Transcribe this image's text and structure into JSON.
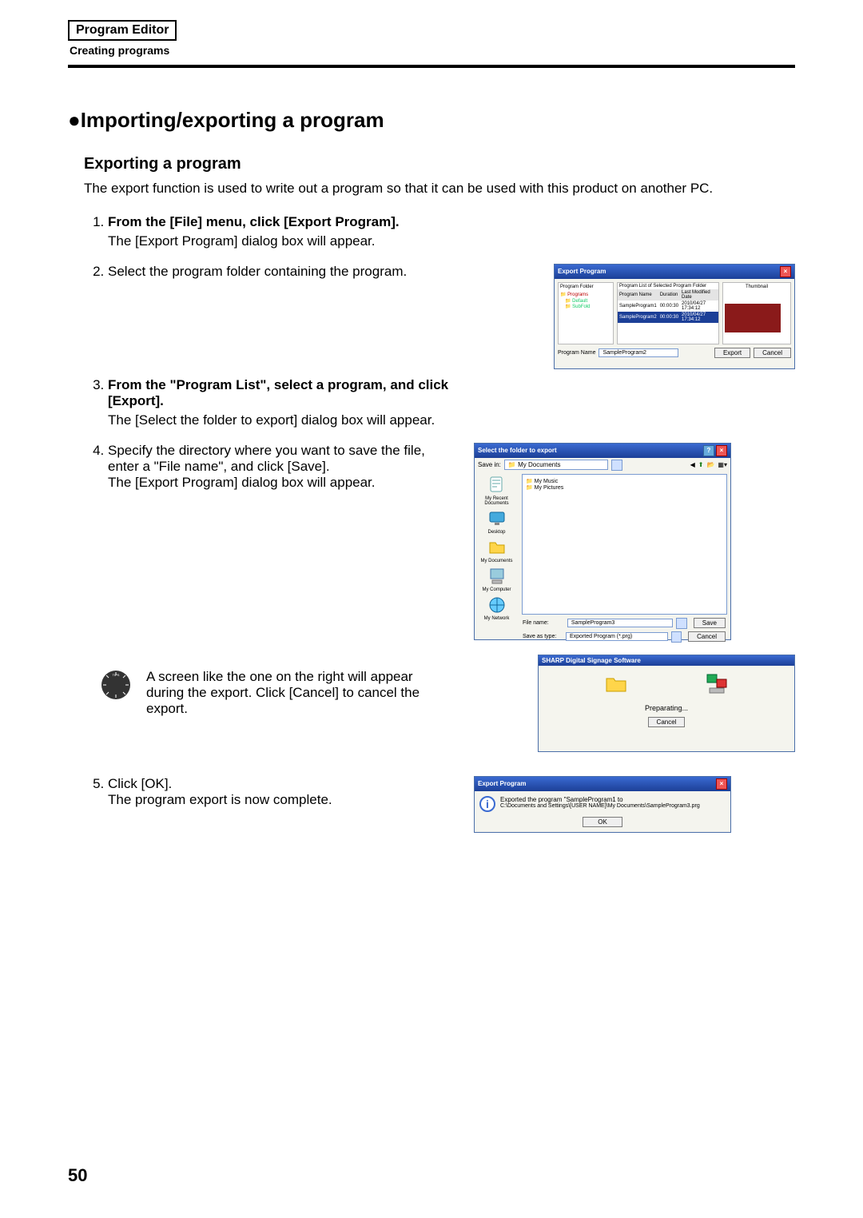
{
  "header": {
    "title": "Program Editor",
    "subtitle": "Creating programs"
  },
  "section": {
    "title": "●Importing/exporting a program"
  },
  "export": {
    "title": "Exporting a program",
    "intro": "The export function is used to write out a program so that it can be used with this product on another PC.",
    "steps": [
      {
        "head": "From the [File] menu, click [Export Program].",
        "body": "The [Export Program] dialog box will appear."
      },
      {
        "head": "Select the program folder containing the program.",
        "body": ""
      },
      {
        "head": "From the \"Program List\", select a program, and click [Export].",
        "body": "The [Select the folder to export] dialog box will appear."
      },
      {
        "head": "Specify the directory where you want to save the file, enter a \"File name\", and click [Save].",
        "body": "The [Export Program] dialog box will appear."
      },
      {
        "head": "Click [OK].",
        "body": "The program export is now complete."
      }
    ],
    "tip": "A screen like the one on the right will appear during the export. Click [Cancel] to cancel the export."
  },
  "dialog1": {
    "title": "Export Program",
    "pf_label": "Program Folder",
    "tree": [
      "Programs",
      "Default",
      "SubFold"
    ],
    "listlabel": "Program List of Selected Program Folder",
    "columns": [
      "Program Name",
      "Duration",
      "Last Modified Date"
    ],
    "rows": [
      {
        "n": "SampleProgram1",
        "d": "00:00:30",
        "m": "2010/04/27 17:34:12",
        "sel": false
      },
      {
        "n": "SampleProgram2",
        "d": "00:00:30",
        "m": "2010/04/27 17:34:12",
        "sel": true
      }
    ],
    "thumb_label": "Thumbnail",
    "pn_label": "Program Name",
    "pn_value": "SampleProgram2",
    "export_btn": "Export",
    "cancel_btn": "Cancel"
  },
  "dialog2": {
    "title": "Select the folder to export",
    "savein_label": "Save in:",
    "savein_value": "My Documents",
    "sidebar": [
      "My Recent Documents",
      "Desktop",
      "My Documents",
      "My Computer",
      "My Network"
    ],
    "files": [
      "My Music",
      "My Pictures"
    ],
    "fn_label": "File name:",
    "fn_value": "SampleProgram3",
    "st_label": "Save as type:",
    "st_value": "Exported Program (*.prg)",
    "save_btn": "Save",
    "cancel_btn": "Cancel"
  },
  "dialog3": {
    "title": "SHARP Digital Signage Software",
    "status": "Preparating...",
    "cancel_btn": "Cancel"
  },
  "dialog4": {
    "title": "Export Program",
    "line1": "Exported the program \"SampleProgram1 to",
    "line2": "C:\\Documents and Settings\\[USER NAME]\\My Documents\\SampleProgram3.prg",
    "ok_btn": "OK"
  },
  "page_number": "50"
}
